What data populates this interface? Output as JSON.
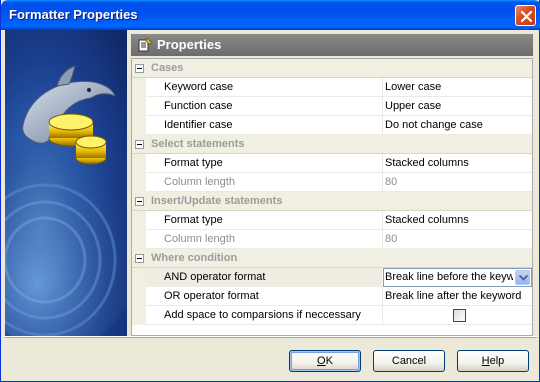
{
  "window": {
    "title": "Formatter Properties",
    "close_icon": "close-icon"
  },
  "header": {
    "title": "Properties",
    "icon": "properties-icon"
  },
  "categories": [
    {
      "label": "Cases",
      "rows": [
        {
          "name": "Keyword case",
          "value": "Lower case",
          "disabled": false
        },
        {
          "name": "Function case",
          "value": "Upper case",
          "disabled": false
        },
        {
          "name": "Identifier case",
          "value": "Do not change case",
          "disabled": false
        }
      ]
    },
    {
      "label": "Select statements",
      "rows": [
        {
          "name": "Format type",
          "value": "Stacked columns",
          "disabled": false
        },
        {
          "name": "Column length",
          "value": "80",
          "disabled": true
        }
      ]
    },
    {
      "label": "Insert/Update statements",
      "rows": [
        {
          "name": "Format type",
          "value": "Stacked columns",
          "disabled": false
        },
        {
          "name": "Column length",
          "value": "80",
          "disabled": true
        }
      ]
    },
    {
      "label": "Where condition",
      "rows": [
        {
          "name": "AND operator format",
          "value": "Break line before the keyword",
          "disabled": false,
          "editor": "combo",
          "selected": true
        },
        {
          "name": "OR operator format",
          "value": "Break line after the keyword",
          "disabled": false
        },
        {
          "name": "Add space to comparsions if neccessary",
          "value": "",
          "disabled": false,
          "editor": "checkbox",
          "checked": false
        }
      ]
    }
  ],
  "buttons": {
    "ok": {
      "pre": "",
      "accel": "O",
      "post": "K"
    },
    "cancel": {
      "label": "Cancel"
    },
    "help": {
      "pre": "",
      "accel": "H",
      "post": "elp"
    }
  },
  "colors": {
    "titlebar": "#0055e8",
    "accent": "#0831d9",
    "category_text": "#9c9c9c",
    "disabled_text": "#8e8e8e"
  }
}
